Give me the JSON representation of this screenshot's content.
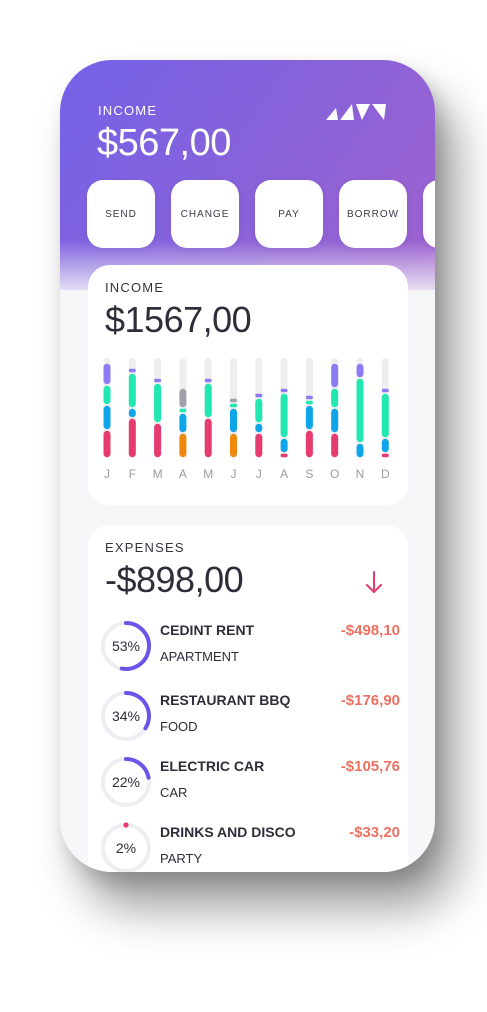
{
  "header": {
    "label": "INCOME",
    "amount": "$567,00",
    "logo_icon": "brand-logo-icon",
    "actions": [
      "SEND",
      "CHANGE",
      "PAY",
      "BORROW",
      ""
    ]
  },
  "income_card": {
    "label": "INCOME",
    "amount": "$1567,00"
  },
  "chart_data": {
    "type": "bar",
    "categories": [
      "J",
      "F",
      "M",
      "A",
      "M",
      "J",
      "J",
      "A",
      "S",
      "O",
      "N",
      "D"
    ],
    "series": [
      {
        "color": "#e63b6f",
        "values": [
          0.28,
          0.4,
          0.35,
          0.0,
          0.4,
          0.0,
          0.25,
          0.05,
          0.28,
          0.25,
          0.0,
          0.05
        ]
      },
      {
        "color": "#f0880e",
        "values": [
          0.0,
          0.0,
          0.0,
          0.25,
          0.0,
          0.25,
          0.0,
          0.0,
          0.0,
          0.0,
          0.0,
          0.0
        ]
      },
      {
        "color": "#0ea5e9",
        "values": [
          0.25,
          0.1,
          0.0,
          0.2,
          0.0,
          0.25,
          0.1,
          0.15,
          0.25,
          0.25,
          0.15,
          0.15
        ]
      },
      {
        "color": "#20e8b0",
        "values": [
          0.2,
          0.35,
          0.4,
          0.05,
          0.35,
          0.05,
          0.25,
          0.45,
          0.05,
          0.2,
          0.65,
          0.45
        ]
      },
      {
        "color": "#a0a0aa",
        "values": [
          0.0,
          0.0,
          0.0,
          0.2,
          0.0,
          0.05,
          0.0,
          0.0,
          0.0,
          0.0,
          0.0,
          0.0
        ]
      },
      {
        "color": "#8b7cf6",
        "values": [
          0.22,
          0.05,
          0.05,
          0.0,
          0.05,
          0.0,
          0.05,
          0.05,
          0.05,
          0.25,
          0.15,
          0.05
        ]
      }
    ],
    "colors": {
      "label": "#9a9aa6",
      "track": "#eeeeef"
    }
  },
  "expenses_card": {
    "label": "EXPENSES",
    "amount": "-$898,00",
    "arrow_icon": "arrow-down-icon",
    "arrow_color": "#e63b6f",
    "items": [
      {
        "pct_label": "53%",
        "pct": 0.53,
        "title": "CEDINT RENT",
        "category": "APARTMENT",
        "amount": "-$498,10"
      },
      {
        "pct_label": "34%",
        "pct": 0.34,
        "title": "RESTAURANT BBQ",
        "category": "FOOD",
        "amount": "-$176,90"
      },
      {
        "pct_label": "22%",
        "pct": 0.22,
        "title": "ELECTRIC CAR",
        "category": "CAR",
        "amount": "-$105,76"
      },
      {
        "pct_label": "2%",
        "pct": 0.02,
        "title": "DRINKS AND DISCO",
        "category": "PARTY",
        "amount": "-$33,20"
      }
    ],
    "ring_colors": {
      "accent": "#6a55e8",
      "small_accent": "#e63b6f",
      "track": "#eeeef2"
    }
  }
}
